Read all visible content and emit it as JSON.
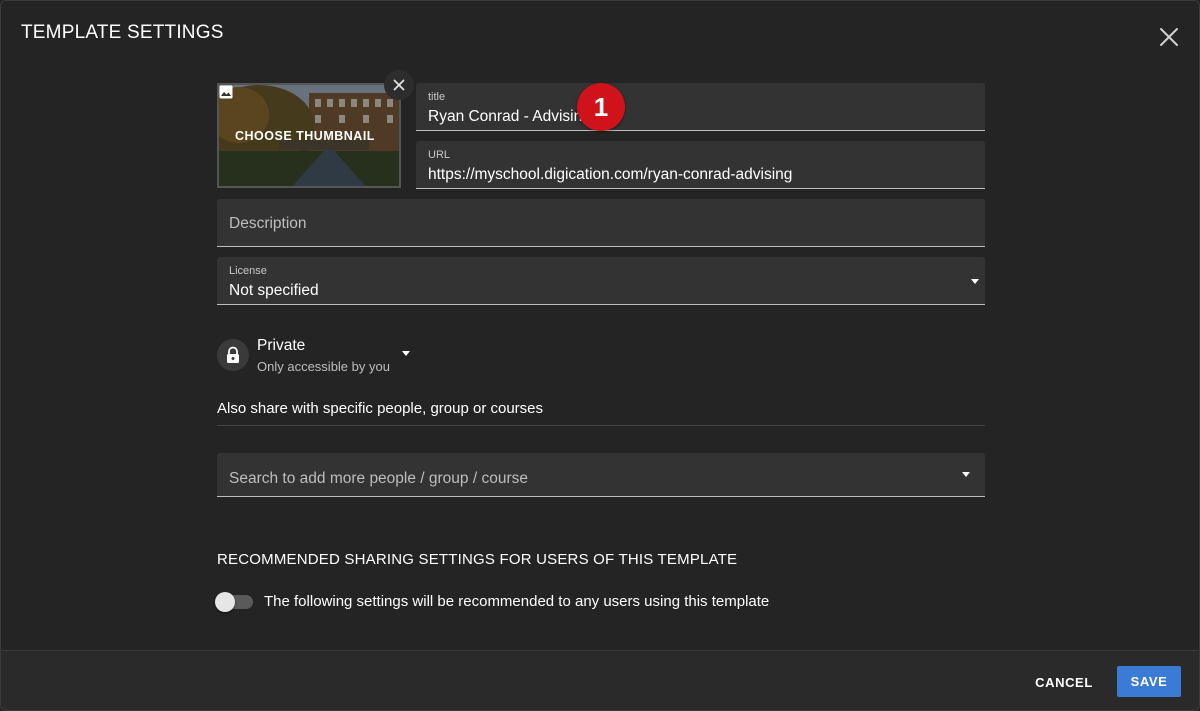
{
  "dialog": {
    "title": "TEMPLATE SETTINGS"
  },
  "thumbnail": {
    "label": "CHOOSE THUMBNAIL"
  },
  "title_field": {
    "label": "title",
    "value": "Ryan Conrad - Advising"
  },
  "url_field": {
    "label": "URL",
    "value": "https://myschool.digication.com/ryan-conrad-advising"
  },
  "description_field": {
    "placeholder": "Description"
  },
  "license_field": {
    "label": "License",
    "value": "Not specified"
  },
  "privacy": {
    "title": "Private",
    "subtitle": "Only accessible by you"
  },
  "sharing": {
    "label": "Also share with specific people, group or courses",
    "search_placeholder": "Search to add more people / group / course"
  },
  "recommended": {
    "heading": "RECOMMENDED SHARING SETTINGS FOR USERS OF THIS TEMPLATE",
    "toggle_label": "The following settings will be recommended to any users using this template",
    "toggle_on": false
  },
  "annotation": {
    "number": "1"
  },
  "footer": {
    "cancel_label": "CANCEL",
    "save_label": "SAVE"
  },
  "colors": {
    "accent": "#3a7bd5",
    "badge": "#d0121b",
    "background": "#242424",
    "field": "#333333"
  }
}
